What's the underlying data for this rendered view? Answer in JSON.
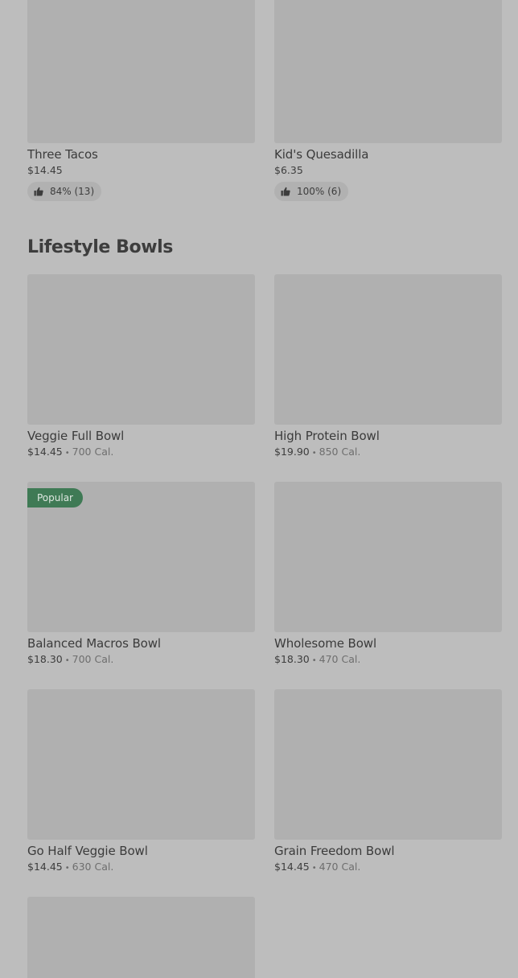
{
  "top_items": [
    {
      "name": "Three Tacos",
      "price": "$14.45",
      "rating": "84% (13)"
    },
    {
      "name": "Kid's Quesadilla",
      "price": "$6.35",
      "rating": "100% (6)"
    }
  ],
  "section": {
    "title": "Lifestyle Bowls"
  },
  "bowls": [
    {
      "name": "Veggie Full Bowl",
      "price": "$14.45",
      "separator": "•",
      "calories": "700 Cal."
    },
    {
      "name": "High Protein Bowl",
      "price": "$19.90",
      "separator": "•",
      "calories": "850 Cal."
    },
    {
      "name": "Balanced Macros Bowl",
      "price": "$18.30",
      "separator": "•",
      "calories": "700 Cal.",
      "badge": "Popular"
    },
    {
      "name": "Wholesome Bowl",
      "price": "$18.30",
      "separator": "•",
      "calories": "470 Cal."
    },
    {
      "name": "Go Half Veggie Bowl",
      "price": "$14.45",
      "separator": "•",
      "calories": "630 Cal."
    },
    {
      "name": "Grain Freedom Bowl",
      "price": "$14.45",
      "separator": "•",
      "calories": "470 Cal."
    }
  ],
  "icons": {
    "rating": "thumbs-up-icon"
  },
  "colors": {
    "badge": "#3f7a55",
    "background": "#bdbdbd",
    "thumbnail": "#b0b0b0"
  }
}
